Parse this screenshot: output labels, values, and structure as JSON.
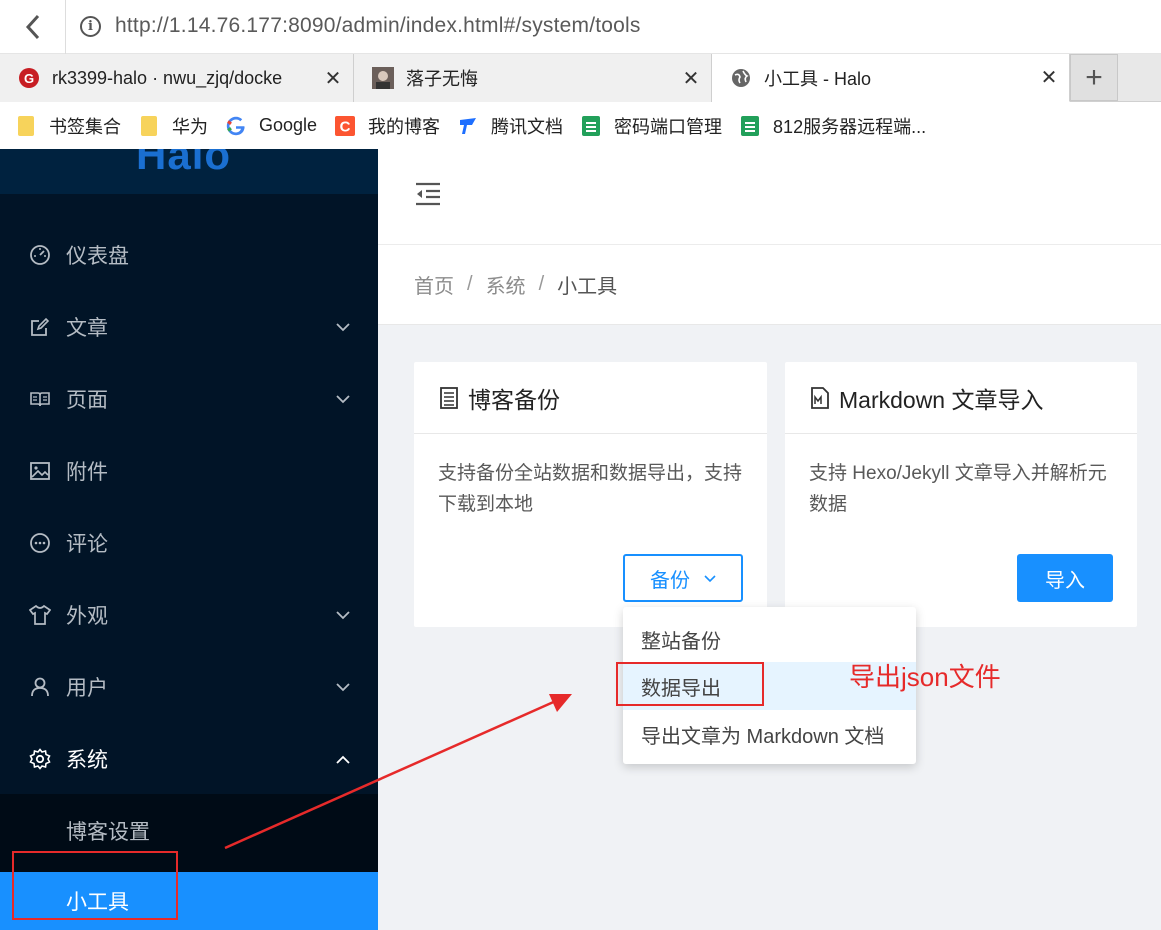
{
  "browser": {
    "url": "http://1.14.76.177:8090/admin/index.html#/system/tools",
    "tabs": [
      {
        "title": "rk3399-halo · nwu_zjq/docke",
        "close": "✕"
      },
      {
        "title": "落子无悔",
        "close": "✕"
      },
      {
        "title": "小工具 - Halo",
        "close": "✕"
      }
    ],
    "new_tab": "+",
    "bookmarks": [
      {
        "label": "书签集合",
        "icon": "folder-icon"
      },
      {
        "label": "华为",
        "icon": "folder-icon"
      },
      {
        "label": "Google",
        "icon": "google-icon"
      },
      {
        "label": "我的博客",
        "icon": "blog-icon"
      },
      {
        "label": "腾讯文档",
        "icon": "tencent-docs-icon"
      },
      {
        "label": "密码端口管理",
        "icon": "sheet-icon"
      },
      {
        "label": "812服务器远程端...",
        "icon": "sheet-icon"
      }
    ]
  },
  "sidebar": {
    "logo": "Halo",
    "items": [
      {
        "label": "仪表盘",
        "icon": "dashboard-icon"
      },
      {
        "label": "文章",
        "icon": "edit-icon"
      },
      {
        "label": "页面",
        "icon": "book-icon"
      },
      {
        "label": "附件",
        "icon": "picture-icon"
      },
      {
        "label": "评论",
        "icon": "comment-icon"
      },
      {
        "label": "外观",
        "icon": "skin-icon"
      },
      {
        "label": "用户",
        "icon": "user-icon"
      },
      {
        "label": "系统",
        "icon": "setting-icon"
      }
    ],
    "submenu": [
      {
        "label": "博客设置"
      },
      {
        "label": "小工具"
      }
    ]
  },
  "breadcrumb": [
    "首页",
    "系统",
    "小工具"
  ],
  "cards": {
    "backup": {
      "title": "博客备份",
      "desc": "支持备份全站数据和数据导出，支持下载到本地",
      "button": "备份"
    },
    "markdown": {
      "title": "Markdown 文章导入",
      "desc": "支持 Hexo/Jekyll 文章导入并解析元数据",
      "button": "导入"
    }
  },
  "dropdown": [
    "整站备份",
    "数据导出",
    "导出文章为 Markdown 文档"
  ],
  "annotation": "导出json文件",
  "colors": {
    "primary": "#1890ff",
    "sidebar": "#011427",
    "annotation": "#e62a2a"
  }
}
